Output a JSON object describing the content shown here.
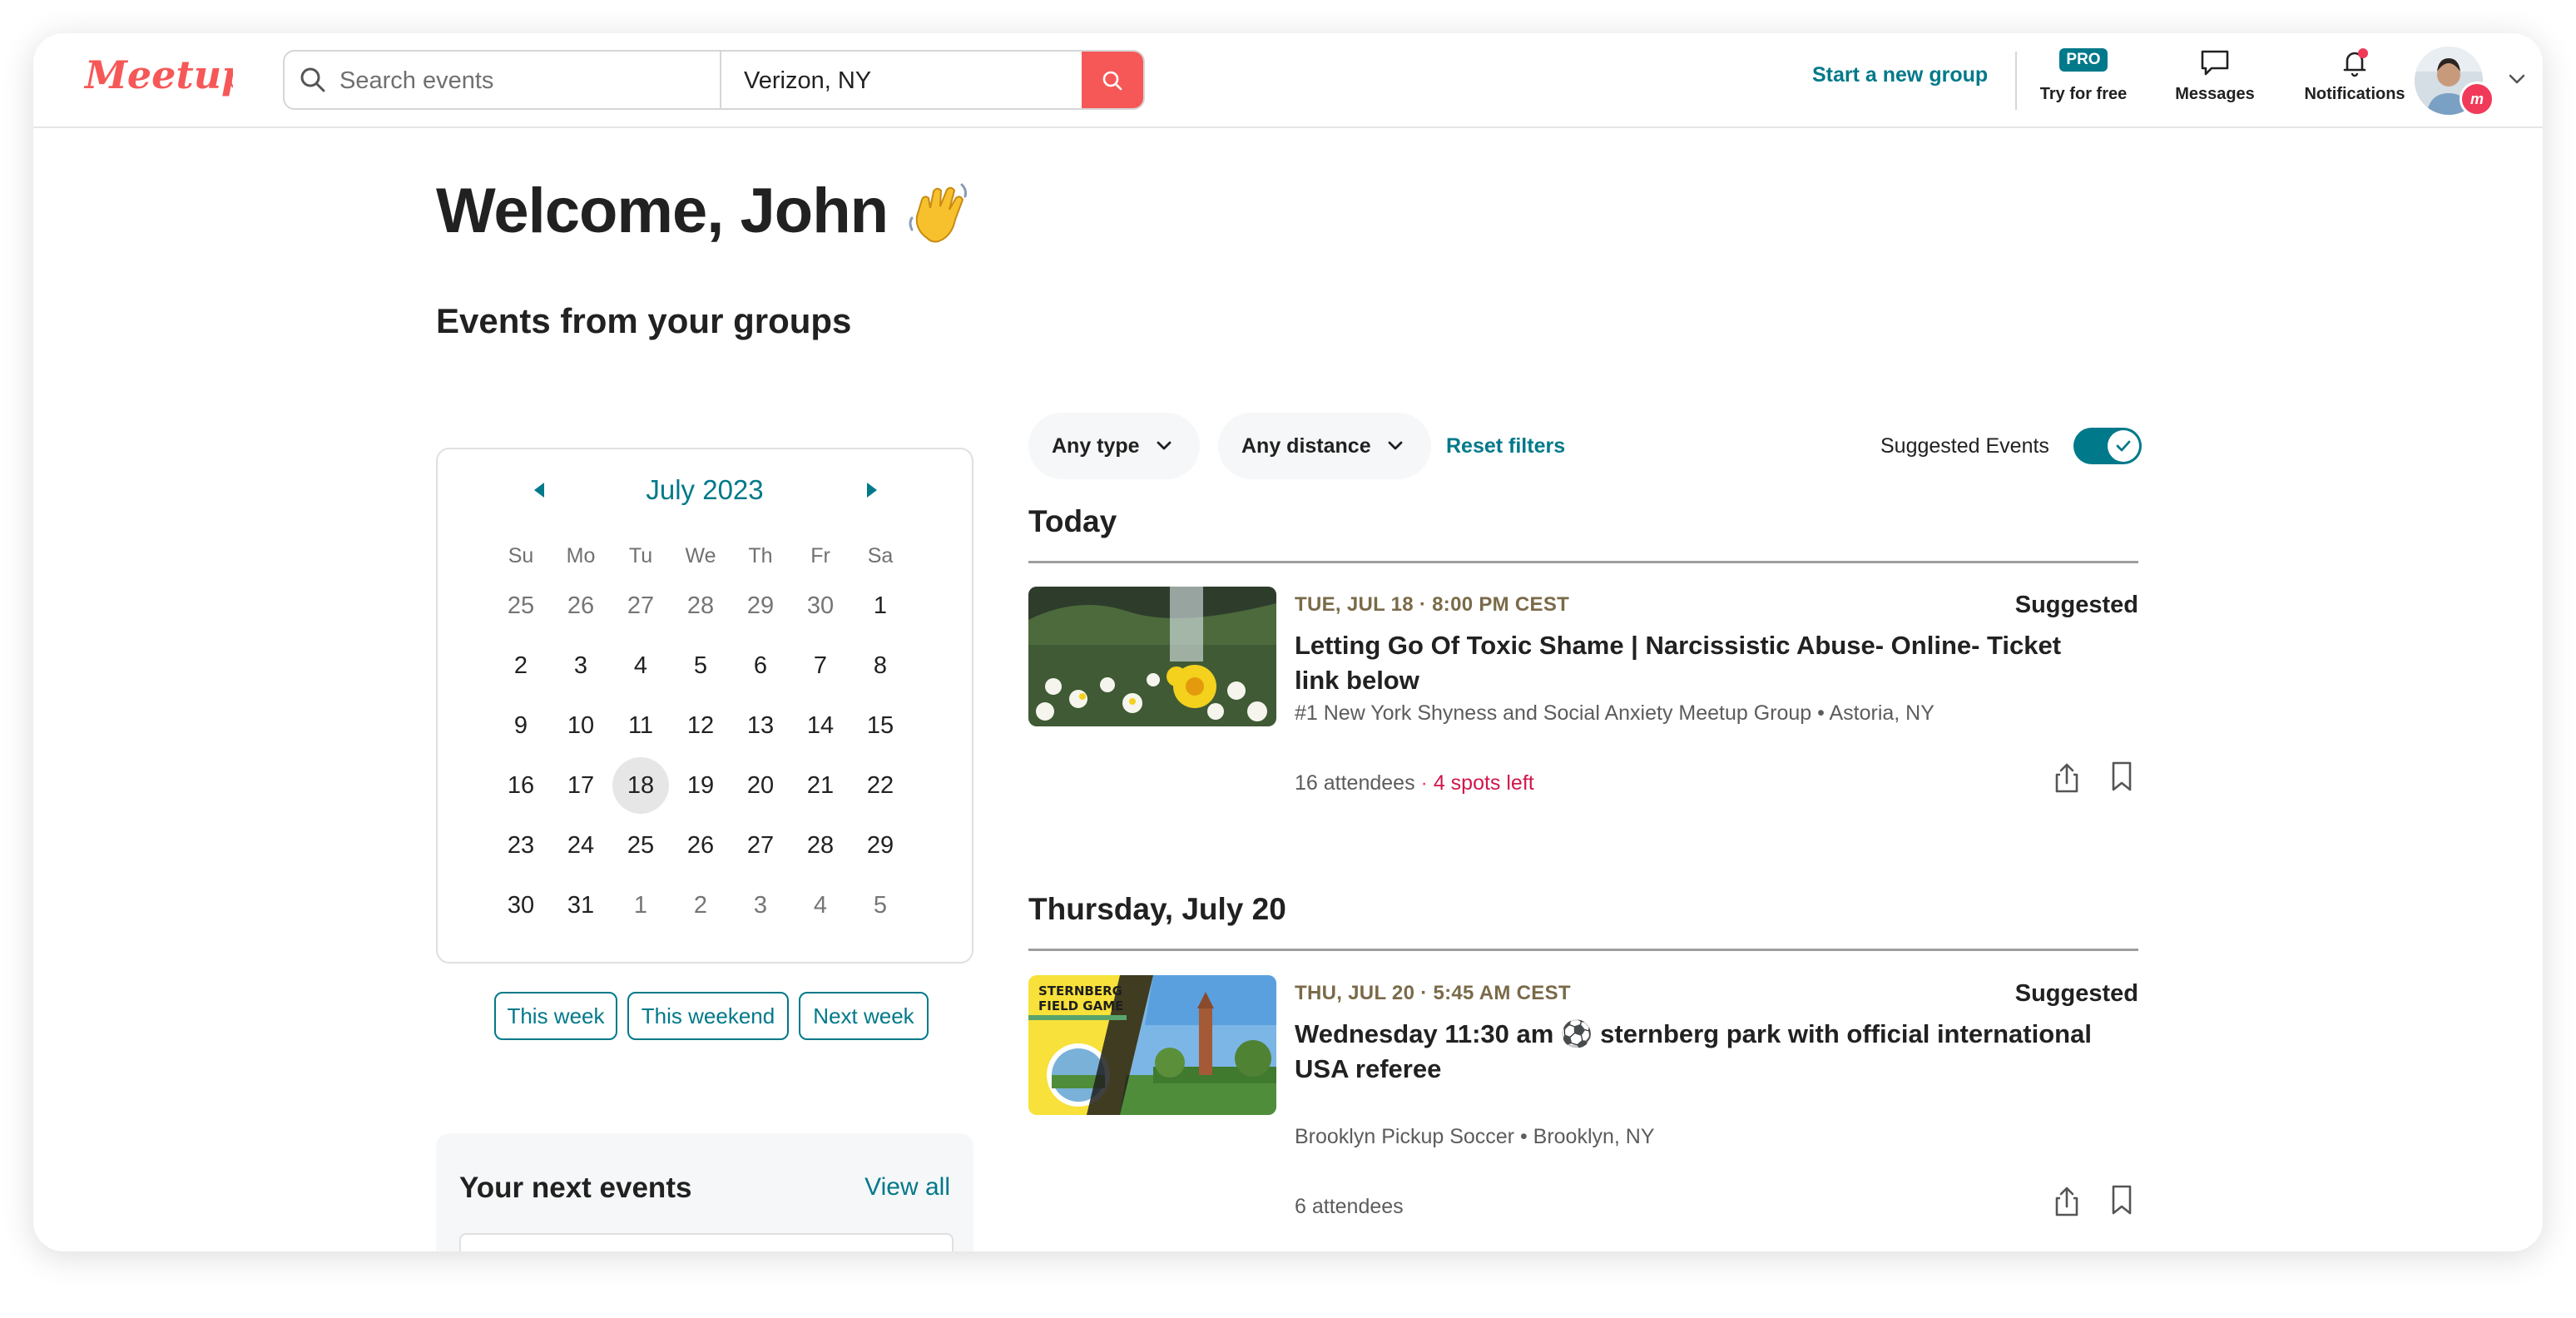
{
  "header": {
    "logo_text": "Meetup",
    "search_placeholder": "Search events",
    "location_value": "Verizon, NY",
    "start_group_label": "Start a new group",
    "pro_badge": "PRO",
    "try_free_label": "Try for free",
    "messages_label": "Messages",
    "notifications_label": "Notifications",
    "avatar_badge": "m"
  },
  "main": {
    "welcome": "Welcome, John",
    "subtitle": "Events from your groups"
  },
  "calendar": {
    "month_label": "July 2023",
    "weekdays": [
      "Su",
      "Mo",
      "Tu",
      "We",
      "Th",
      "Fr",
      "Sa"
    ],
    "days": [
      {
        "d": "25",
        "out": true
      },
      {
        "d": "26",
        "out": true
      },
      {
        "d": "27",
        "out": true
      },
      {
        "d": "28",
        "out": true
      },
      {
        "d": "29",
        "out": true
      },
      {
        "d": "30",
        "out": true
      },
      {
        "d": "1"
      },
      {
        "d": "2"
      },
      {
        "d": "3"
      },
      {
        "d": "4"
      },
      {
        "d": "5"
      },
      {
        "d": "6"
      },
      {
        "d": "7"
      },
      {
        "d": "8"
      },
      {
        "d": "9"
      },
      {
        "d": "10"
      },
      {
        "d": "11"
      },
      {
        "d": "12"
      },
      {
        "d": "13"
      },
      {
        "d": "14"
      },
      {
        "d": "15"
      },
      {
        "d": "16"
      },
      {
        "d": "17"
      },
      {
        "d": "18",
        "selected": true
      },
      {
        "d": "19"
      },
      {
        "d": "20"
      },
      {
        "d": "21"
      },
      {
        "d": "22"
      },
      {
        "d": "23"
      },
      {
        "d": "24"
      },
      {
        "d": "25"
      },
      {
        "d": "26"
      },
      {
        "d": "27"
      },
      {
        "d": "28"
      },
      {
        "d": "29"
      },
      {
        "d": "30"
      },
      {
        "d": "31"
      },
      {
        "d": "1",
        "out": true
      },
      {
        "d": "2",
        "out": true
      },
      {
        "d": "3",
        "out": true
      },
      {
        "d": "4",
        "out": true
      },
      {
        "d": "5",
        "out": true
      }
    ],
    "quick_filters": [
      "This week",
      "This weekend",
      "Next week"
    ]
  },
  "next_events": {
    "title": "Your next events",
    "view_all": "View all"
  },
  "filters": {
    "type_label": "Any type",
    "distance_label": "Any distance",
    "reset_label": "Reset filters",
    "suggested_label": "Suggested Events",
    "suggested_on": true
  },
  "sections": [
    {
      "heading": "Today",
      "event": {
        "date": "TUE, JUL 18 · 8:00 PM CEST",
        "suggested": "Suggested",
        "title": "Letting Go Of Toxic Shame | Narcissistic Abuse- Online- Ticket link below",
        "group": "#1 New York Shyness and Social Anxiety Meetup Group • Astoria, NY",
        "attendees": "16 attendees",
        "spots": "4 spots left"
      }
    },
    {
      "heading": "Thursday, July 20",
      "event": {
        "date": "THU, JUL 20 · 5:45 AM CEST",
        "suggested": "Suggested",
        "title": "Wednesday 11:30 am ⚽ sternberg park with official international USA referee",
        "group": "Brooklyn Pickup Soccer • Brooklyn, NY",
        "attendees": "6 attendees",
        "image_text": "STERNBERG FIELD GAME"
      }
    }
  ],
  "colors": {
    "brand": "#f65858",
    "teal": "#00798a",
    "spots": "#d1164b",
    "date": "#7a6a48"
  }
}
